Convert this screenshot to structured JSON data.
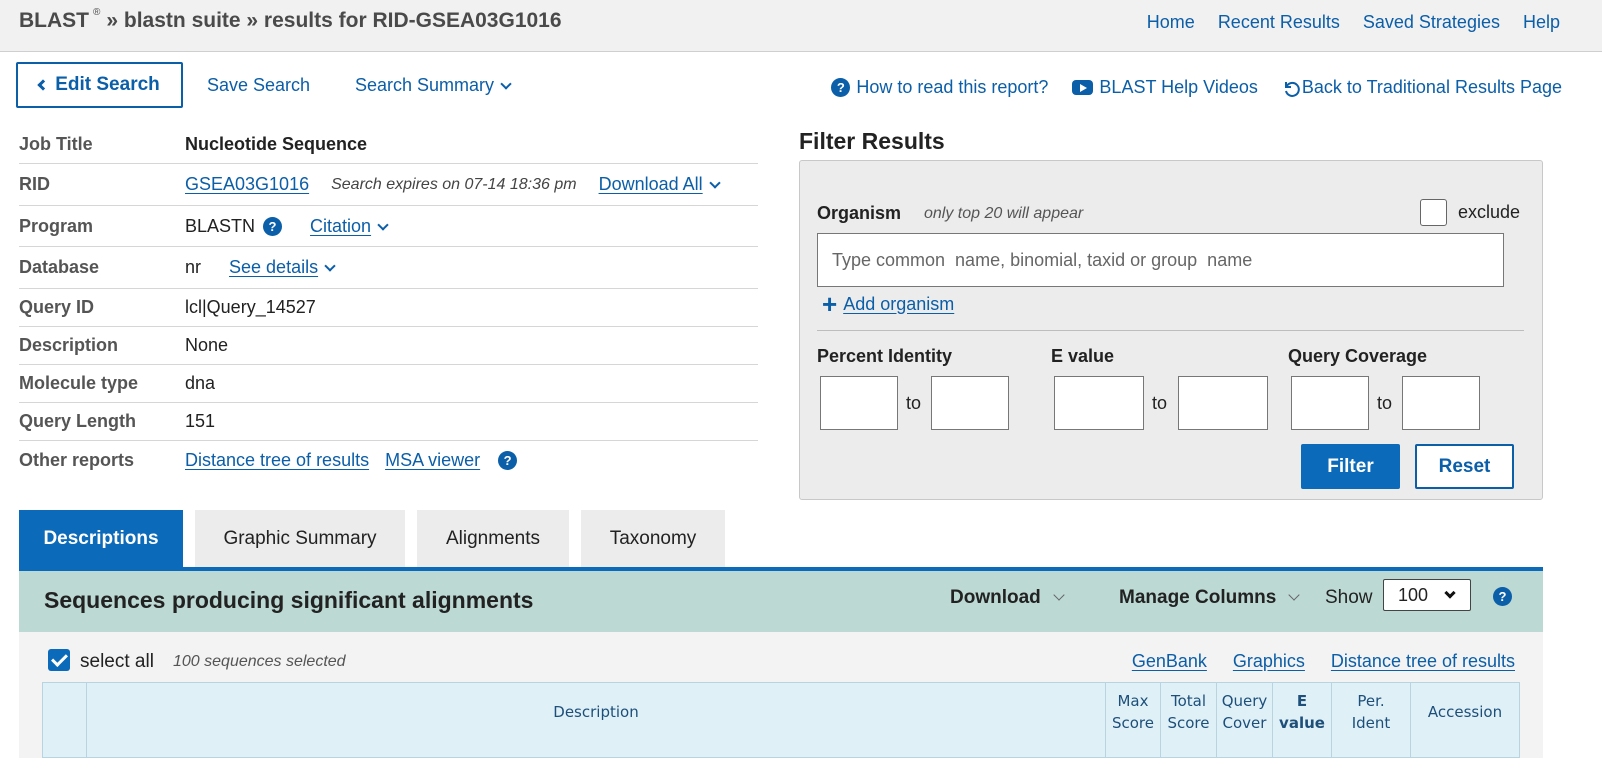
{
  "header": {
    "crumb_brand": "BLAST",
    "crumb_reg": "®",
    "crumb_rest": "» blastn suite » results for RID-GSEA03G1016",
    "nav": [
      "Home",
      "Recent Results",
      "Saved Strategies",
      "Help"
    ]
  },
  "toolbar": {
    "edit_search": "Edit Search",
    "save_search": "Save Search",
    "search_summary": "Search Summary",
    "how_to_read": "How to read this report?",
    "help_videos": "BLAST Help Videos",
    "back_traditional": "Back to Traditional Results Page"
  },
  "job": {
    "job_title_label": "Job Title",
    "job_title": "Nucleotide Sequence",
    "rid_label": "RID",
    "rid": "GSEA03G1016",
    "expires": "Search expires on 07-14 18:36 pm",
    "download_all": "Download All",
    "program_label": "Program",
    "program": "BLASTN",
    "citation": "Citation",
    "database_label": "Database",
    "database": "nr",
    "see_details": "See details",
    "query_id_label": "Query ID",
    "query_id": "lcl|Query_14527",
    "description_label": "Description",
    "description": "None",
    "molecule_label": "Molecule type",
    "molecule": "dna",
    "length_label": "Query Length",
    "length": "151",
    "other_label": "Other reports",
    "distance_tree": "Distance tree of results",
    "msa_viewer": "MSA viewer"
  },
  "filter": {
    "title": "Filter Results",
    "organism_label": "Organism",
    "organism_hint": "only top 20 will appear",
    "exclude_label": "exclude",
    "organism_placeholder": "Type common  name, binomial, taxid or group  name",
    "add_organism": "Add organism",
    "percent_identity": "Percent Identity",
    "e_value": "E value",
    "query_coverage": "Query Coverage",
    "to": "to",
    "filter_btn": "Filter",
    "reset_btn": "Reset"
  },
  "tabs": [
    "Descriptions",
    "Graphic Summary",
    "Alignments",
    "Taxonomy"
  ],
  "results": {
    "title": "Sequences producing significant alignments",
    "download": "Download",
    "manage_columns": "Manage Columns",
    "show_label": "Show",
    "show_value": "100",
    "select_all": "select all",
    "selected_count": "100 sequences selected",
    "links": [
      "GenBank",
      "Graphics",
      "Distance tree of results"
    ],
    "columns": {
      "description": "Description",
      "max_score_1": "Max",
      "max_score_2": "Score",
      "total_score_1": "Total",
      "total_score_2": "Score",
      "query_cover_1": "Query",
      "query_cover_2": "Cover",
      "e_value_1": "E",
      "e_value_2": "value",
      "per_ident_1": "Per.",
      "per_ident_2": "Ident",
      "accession": "Accession"
    }
  },
  "colors": {
    "primary": "#0b6ab9",
    "link": "#0b5ea8",
    "results_header_bg": "#bcd9d4",
    "table_header_bg": "#dff0f7"
  }
}
